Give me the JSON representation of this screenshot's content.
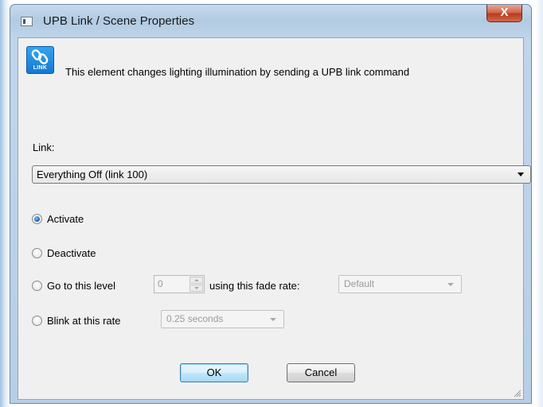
{
  "window": {
    "title": "UPB Link / Scene Properties",
    "close_glyph": "X"
  },
  "header": {
    "icon": "link-icon",
    "icon_label": "LINK",
    "description": "This element changes lighting illumination by sending a UPB link command"
  },
  "link": {
    "label": "Link:",
    "selected": "Everything Off (link 100)"
  },
  "options": {
    "selected": "activate",
    "activate": "Activate",
    "deactivate": "Deactivate",
    "goto_label": "Go to this level",
    "goto_level_value": "0",
    "fade_rate_label": "using this fade rate:",
    "fade_rate_value": "Default",
    "blink_label": "Blink at this rate",
    "blink_rate_value": "0.25 seconds"
  },
  "buttons": {
    "ok": "OK",
    "cancel": "Cancel"
  },
  "colors": {
    "accent": "#1378d4",
    "close": "#c9452a",
    "frame": "#b7cfe6"
  }
}
